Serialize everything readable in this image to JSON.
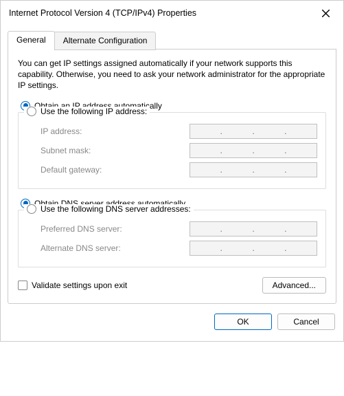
{
  "window": {
    "title": "Internet Protocol Version 4 (TCP/IPv4) Properties"
  },
  "tabs": {
    "general": "General",
    "alternate": "Alternate Configuration"
  },
  "intro": "You can get IP settings assigned automatically if your network supports this capability. Otherwise, you need to ask your network administrator for the appropriate IP settings.",
  "ip": {
    "auto": "Obtain an IP address automatically",
    "manual": "Use the following IP address:",
    "address": "IP address:",
    "subnet": "Subnet mask:",
    "gateway": "Default gateway:"
  },
  "dns": {
    "auto": "Obtain DNS server address automatically",
    "manual": "Use the following DNS server addresses:",
    "preferred": "Preferred DNS server:",
    "alternate": "Alternate DNS server:"
  },
  "validate": "Validate settings upon exit",
  "buttons": {
    "advanced": "Advanced...",
    "ok": "OK",
    "cancel": "Cancel"
  }
}
